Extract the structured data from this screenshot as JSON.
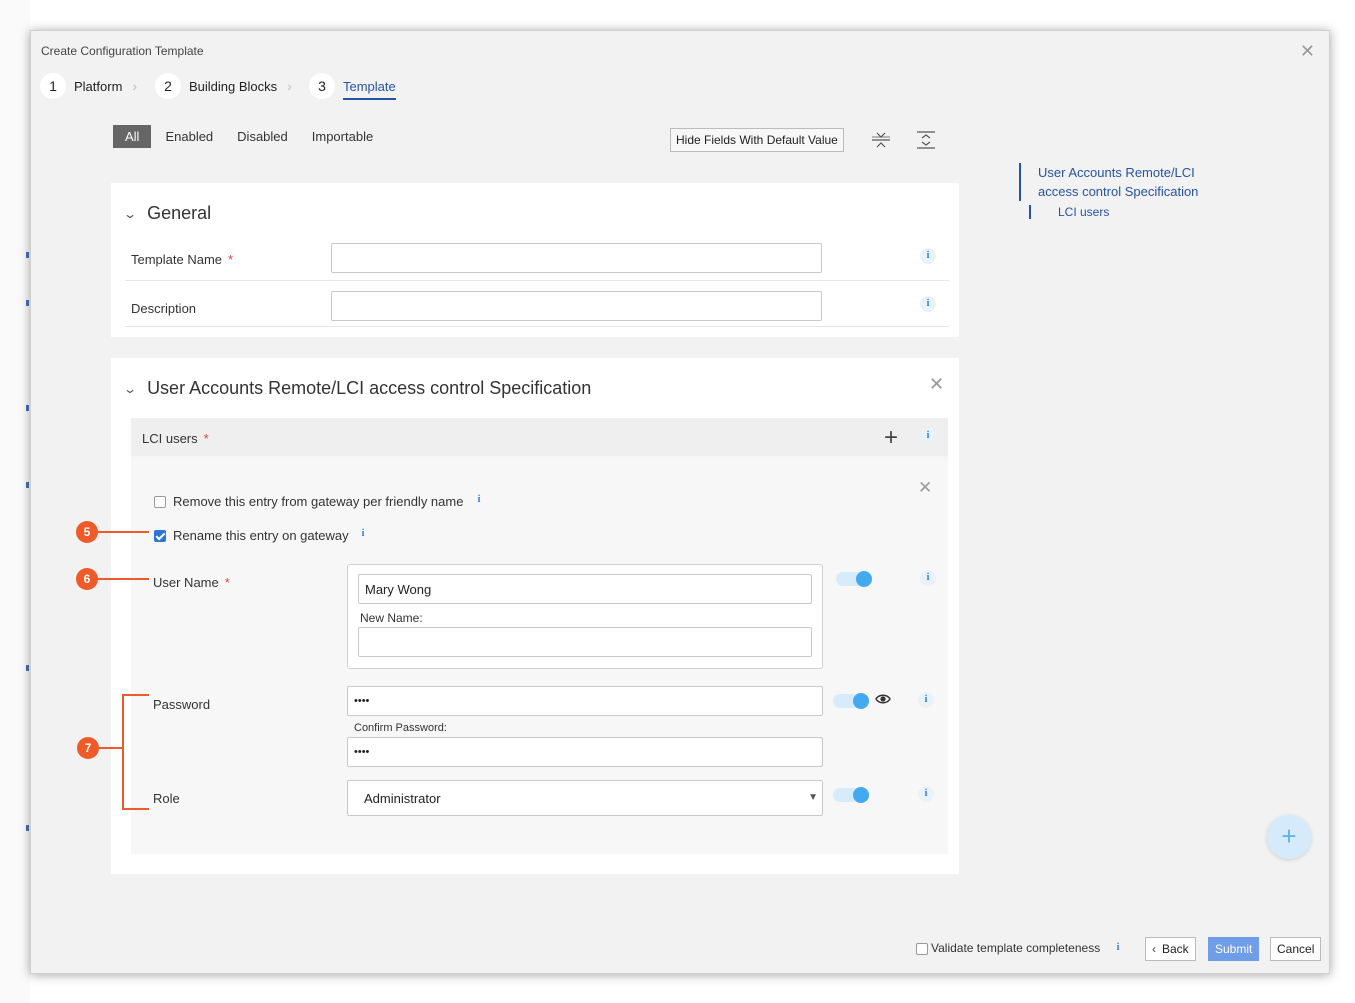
{
  "dialog": {
    "title": "Create Configuration Template",
    "close_icon": "close-icon"
  },
  "wizard": {
    "steps": [
      {
        "num": "1",
        "label": "Platform"
      },
      {
        "num": "2",
        "label": "Building Blocks"
      },
      {
        "num": "3",
        "label": "Template",
        "active": true
      }
    ]
  },
  "filters": {
    "all": "All",
    "enabled": "Enabled",
    "disabled": "Disabled",
    "importable": "Importable",
    "selected": "All"
  },
  "toolbar": {
    "hide_fields_label": "Hide Fields With Default Value",
    "collapse_icon": "collapse-all-icon",
    "expand_icon": "expand-all-icon"
  },
  "toc": {
    "item": "User Accounts Remote/LCI access control Specification",
    "item_line1": "User Accounts Remote/LCI",
    "item_line2": "access control Specification",
    "sub": "LCI users"
  },
  "general": {
    "title": "General",
    "template_name_label": "Template Name",
    "template_name_value": "",
    "description_label": "Description",
    "description_value": "",
    "required_mark": "*",
    "info_glyph": "i"
  },
  "spec": {
    "title": "User Accounts Remote/LCI access control Specification",
    "lci_users_label": "LCI users",
    "remove_entry_label": "Remove this entry from gateway per friendly name",
    "remove_entry_checked": false,
    "rename_entry_label": "Rename this entry on gateway",
    "rename_entry_checked": true,
    "user_name_label": "User Name",
    "user_name_value": "Mary Wong",
    "new_name_label": "New Name:",
    "new_name_value": "",
    "password_label": "Password",
    "password_value": "••••",
    "confirm_password_label": "Confirm Password:",
    "confirm_password_value": "••••",
    "role_label": "Role",
    "role_value": "Administrator"
  },
  "callouts": {
    "five": "5",
    "six": "6",
    "seven": "7",
    "color": "#ef5a28"
  },
  "footer": {
    "validate_label": "Validate template completeness",
    "validate_checked": false,
    "back_label": "Back",
    "submit_label": "Submit",
    "cancel_label": "Cancel"
  },
  "colors": {
    "accent": "#2553a5",
    "submit_bg": "#6f9de8",
    "toggle_on": "#44aaf0"
  }
}
